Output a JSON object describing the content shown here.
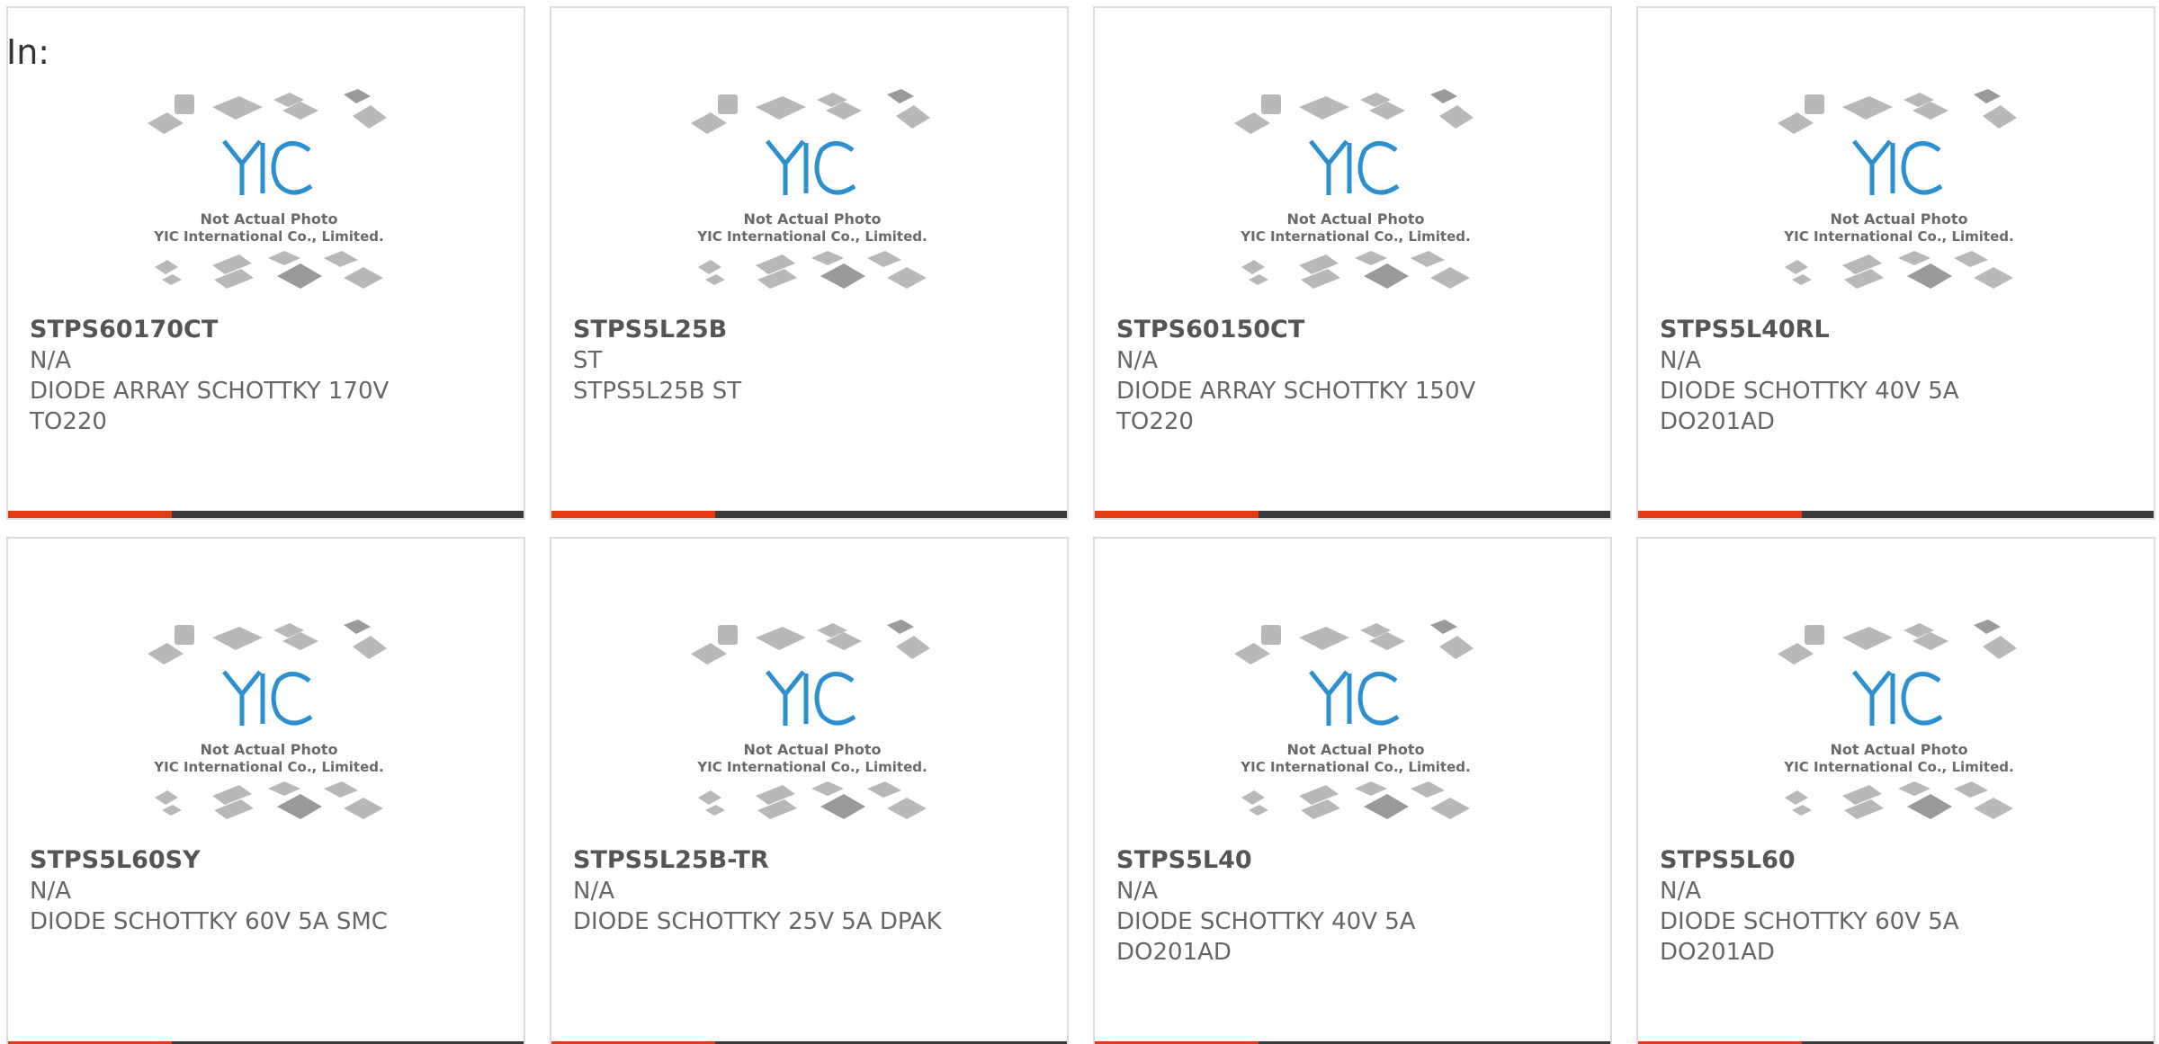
{
  "heading": "In:",
  "colors": {
    "accent": "#e23a12",
    "bar": "#3a3a3a",
    "logo": "#2b8fd0"
  },
  "placeholder": {
    "line1": "Not Actual Photo",
    "line2": "YIC International Co., Limited.",
    "logo_text": "YIC"
  },
  "products": [
    {
      "part": "STPS60170CT",
      "brand": "N/A",
      "desc": "DIODE ARRAY SCHOTTKY 170V",
      "pkg": "TO220"
    },
    {
      "part": "STPS5L25B",
      "brand": "ST",
      "desc": "STPS5L25B ST",
      "pkg": ""
    },
    {
      "part": "STPS60150CT",
      "brand": "N/A",
      "desc": "DIODE ARRAY SCHOTTKY 150V",
      "pkg": "TO220"
    },
    {
      "part": "STPS5L40RL",
      "brand": "N/A",
      "desc": "DIODE SCHOTTKY 40V 5A",
      "pkg": "DO201AD"
    },
    {
      "part": "STPS5L60SY",
      "brand": "N/A",
      "desc": "DIODE SCHOTTKY 60V 5A SMC",
      "pkg": ""
    },
    {
      "part": "STPS5L25B-TR",
      "brand": "N/A",
      "desc": "DIODE SCHOTTKY 25V 5A DPAK",
      "pkg": ""
    },
    {
      "part": "STPS5L40",
      "brand": "N/A",
      "desc": "DIODE SCHOTTKY 40V 5A",
      "pkg": "DO201AD"
    },
    {
      "part": "STPS5L60",
      "brand": "N/A",
      "desc": "DIODE SCHOTTKY 60V 5A",
      "pkg": "DO201AD"
    }
  ]
}
